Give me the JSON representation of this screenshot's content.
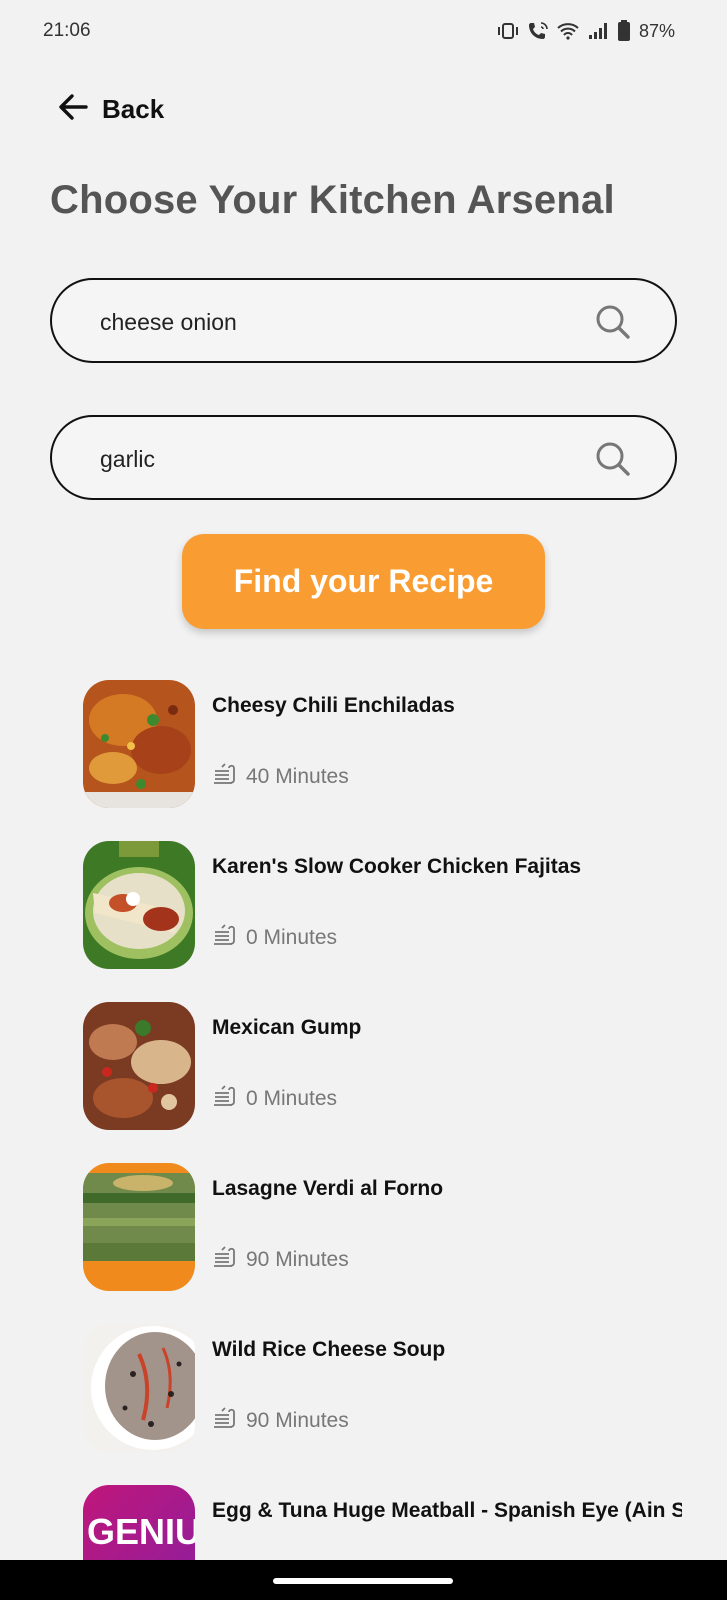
{
  "status_bar": {
    "time": "21:06",
    "battery": "87%",
    "icons": [
      "vibrate-icon",
      "wifi-call-icon",
      "wifi-icon",
      "signal-icon",
      "battery-icon"
    ]
  },
  "header": {
    "back_label": "Back",
    "title": "Choose Your Kitchen Arsenal"
  },
  "search": {
    "field1_value": "cheese onion",
    "field2_value": "garlic"
  },
  "find_button_label": "Find your Recipe",
  "colors": {
    "accent": "#f99d32",
    "background": "#f2f2f2",
    "title_gray": "#555555",
    "meta_gray": "#777777"
  },
  "recipes": [
    {
      "title": "Cheesy Chili Enchiladas",
      "time": "40 Minutes"
    },
    {
      "title": "Karen's Slow Cooker Chicken Fajitas",
      "time": "0 Minutes"
    },
    {
      "title": "Mexican Gump",
      "time": "0 Minutes"
    },
    {
      "title": "Lasagne Verdi al Forno",
      "time": "90 Minutes"
    },
    {
      "title": "Wild Rice Cheese Soup",
      "time": "90 Minutes"
    },
    {
      "title": "Egg & Tuna Huge Meatball - Spanish Eye (Ain Saif)",
      "thumb_text": "GENIU"
    }
  ]
}
